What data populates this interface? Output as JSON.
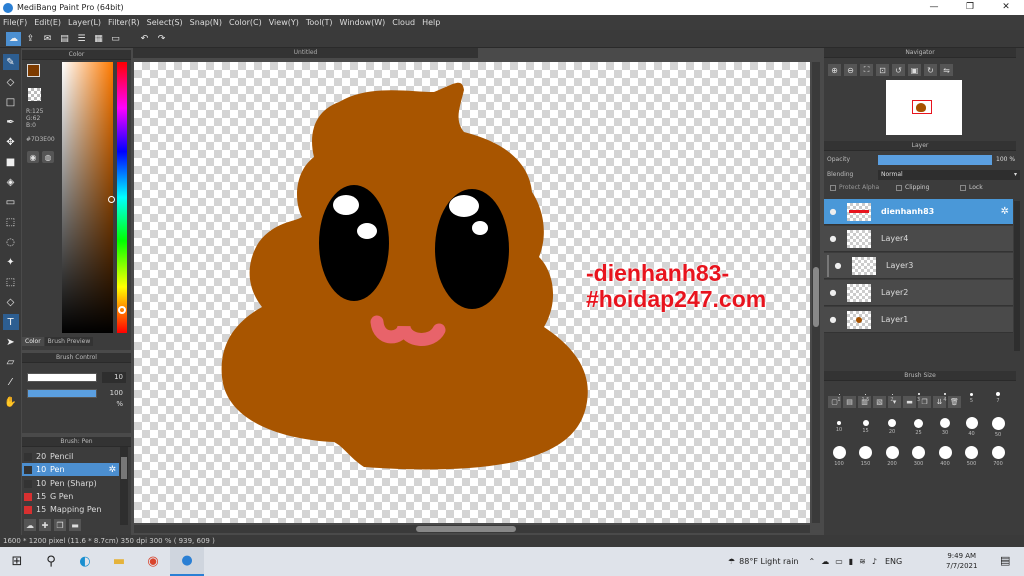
{
  "window": {
    "title": "MediBang Paint Pro (64bit)",
    "minimize": "—",
    "maximize": "❐",
    "close": "✕"
  },
  "menu": [
    "File(F)",
    "Edit(E)",
    "Layer(L)",
    "Filter(R)",
    "Select(S)",
    "Snap(N)",
    "Color(C)",
    "View(Y)",
    "Tool(T)",
    "Window(W)",
    "Cloud",
    "Help"
  ],
  "color_panel": {
    "title": "Color",
    "r": "R:125",
    "g": "G:62",
    "b": "B:0",
    "hex": "#7D3E00",
    "tab_color": "Color",
    "tab_preview": "Brush Preview",
    "current_color": "#7d3e00"
  },
  "brush_control": {
    "title": "Brush Control",
    "size_value": "10",
    "opacity_value": "100 %"
  },
  "brush_list": {
    "title": "Brush: Pen",
    "items": [
      {
        "size": "20",
        "name": "Pencil",
        "color": "#333333"
      },
      {
        "size": "10",
        "name": "Pen",
        "color": "#333333"
      },
      {
        "size": "10",
        "name": "Pen (Sharp)",
        "color": "#333333"
      },
      {
        "size": "15",
        "name": "G Pen",
        "color": "#d83030"
      },
      {
        "size": "15",
        "name": "Mapping Pen",
        "color": "#d83030"
      }
    ]
  },
  "document": {
    "tab": "Untitled",
    "watermark_line1": "-dienhanh83-",
    "watermark_line2": "#hoidap247.com"
  },
  "navigator": {
    "title": "Navigator"
  },
  "layer_panel": {
    "title": "Layer",
    "opacity_label": "Opacity",
    "opacity_value": "100 %",
    "blending_label": "Blending",
    "blending_value": "Normal",
    "protect_alpha": "Protect Alpha",
    "clipping": "Clipping",
    "lock": "Lock",
    "layers": [
      {
        "name": "dienhanh83"
      },
      {
        "name": "Layer4"
      },
      {
        "name": "Layer3"
      },
      {
        "name": "Layer2"
      },
      {
        "name": "Layer1"
      }
    ]
  },
  "brush_size": {
    "title": "Brush Size",
    "sizes": [
      "1",
      "1.5",
      "2",
      "3",
      "4",
      "5",
      "7",
      "10",
      "15",
      "20",
      "25",
      "30",
      "40",
      "50",
      "100",
      "150",
      "200",
      "300",
      "400",
      "500",
      "700"
    ]
  },
  "status": {
    "text": "1600 * 1200 pixel   (11.6 * 8.7cm)   350 dpi   300 %   ( 939, 609 )"
  },
  "taskbar": {
    "weather": "88°F  Light rain",
    "lang": "ENG",
    "time": "9:49 AM",
    "date": "7/7/2021"
  }
}
